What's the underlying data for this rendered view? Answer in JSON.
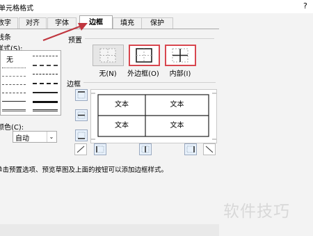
{
  "window": {
    "title": "单元格格式",
    "help": "?"
  },
  "tabs": [
    {
      "label": "数字"
    },
    {
      "label": "对齐"
    },
    {
      "label": "字体"
    },
    {
      "label": "边框",
      "active": true
    },
    {
      "label": "填充"
    },
    {
      "label": "保护"
    }
  ],
  "line_section": {
    "title": "线条",
    "style_label": "样式(S):",
    "none_label": "无",
    "color_label": "颜色(C):",
    "color_value": "自动"
  },
  "presets": {
    "title": "预置",
    "items": [
      {
        "label": "无(N)"
      },
      {
        "label": "外边框(O)"
      },
      {
        "label": "内部(I)"
      }
    ]
  },
  "border": {
    "title": "边框",
    "preview_cells": [
      "文本",
      "文本",
      "文本",
      "文本"
    ]
  },
  "hint": "单击预置选项、预览草图及上面的按钮可以添加边框样式。",
  "watermark": "软件技巧",
  "colors": {
    "accent_red": "#d8474f",
    "arrow": "#c0363f"
  }
}
